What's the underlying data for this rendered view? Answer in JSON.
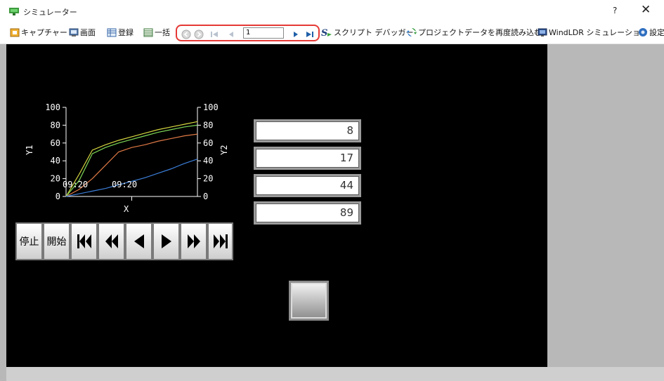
{
  "window": {
    "title": "シミュレーター",
    "help_label": "?",
    "close_label": "✕"
  },
  "toolbar": {
    "capture": "キャプチャー",
    "screen": "画面",
    "register": "登録",
    "batch": "一括",
    "page_number": "1",
    "script_debugger": "スクリプト デバッガー",
    "reload_project": "プロジェクトデータを再度読み込む",
    "windldr_sim": "WindLDR シミュレーション",
    "settings": "設定"
  },
  "colors": {
    "screen_bg": "#000000",
    "highlight_frame": "#e53935",
    "series_yellow": "#d6d640",
    "series_green": "#7ed957",
    "series_orange": "#e07a45",
    "series_blue": "#3c7fd9"
  },
  "chart_data": {
    "type": "line",
    "xlabel": "X",
    "ylabel_left": "Y1",
    "ylabel_right": "Y2",
    "ylim": [
      0,
      100
    ],
    "yticks": [
      "0",
      "20",
      "40",
      "60",
      "80",
      "100"
    ],
    "x_tick_labels": [
      "09:20",
      "09:20"
    ],
    "x": [
      0,
      1,
      2,
      3,
      4,
      5,
      6,
      7,
      8,
      9,
      10
    ],
    "series": [
      {
        "color": "#d6d640",
        "values": [
          0,
          25,
          52,
          58,
          63,
          67,
          71,
          75,
          78,
          81,
          84
        ]
      },
      {
        "color": "#7ed957",
        "values": [
          0,
          18,
          48,
          55,
          60,
          64,
          68,
          72,
          75,
          78,
          80
        ]
      },
      {
        "color": "#e07a45",
        "values": [
          0,
          8,
          20,
          35,
          50,
          55,
          58,
          62,
          65,
          68,
          70
        ]
      },
      {
        "color": "#3c7fd9",
        "values": [
          0,
          3,
          6,
          9,
          13,
          17,
          21,
          26,
          31,
          37,
          42
        ]
      }
    ]
  },
  "numeric_displays": [
    "8",
    "17",
    "44",
    "89"
  ],
  "controls": {
    "stop": "停止",
    "start": "開始",
    "first_icon": "skip-first-icon",
    "rewind_icon": "rewind-icon",
    "prev_icon": "step-back-icon",
    "next_icon": "step-forward-icon",
    "fast_forward_icon": "fast-forward-icon",
    "last_icon": "skip-last-icon"
  }
}
